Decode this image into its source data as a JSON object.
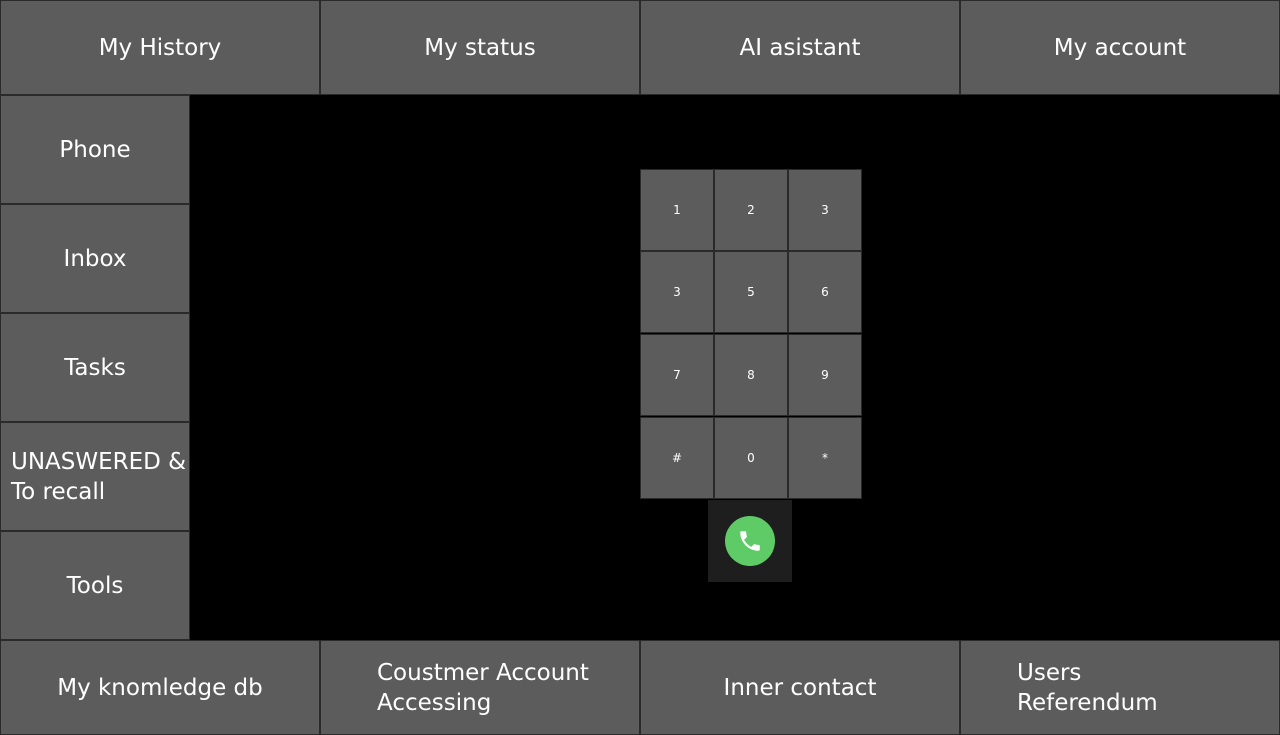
{
  "top_nav": {
    "history": "My History",
    "status": "My status",
    "ai": "AI asistant",
    "account": "My account"
  },
  "sidebar": {
    "items": [
      {
        "label": "Phone"
      },
      {
        "label": "Inbox"
      },
      {
        "label": "Tasks"
      },
      {
        "label": "UNASWERED &\nTo recall"
      },
      {
        "label": "Tools"
      }
    ]
  },
  "bottom_nav": {
    "knowledge": "My knomledge db",
    "customer": "Coustmer Account\nAccessing",
    "inner": "Inner contact",
    "users": "Users\nReferendum"
  },
  "keypad": {
    "keys": [
      "1",
      "2",
      "3",
      "3",
      "5",
      "6",
      "7",
      "8",
      "9",
      "#",
      "0",
      "*"
    ]
  },
  "call": {
    "icon": "phone-icon",
    "color": "#5ecb67"
  }
}
